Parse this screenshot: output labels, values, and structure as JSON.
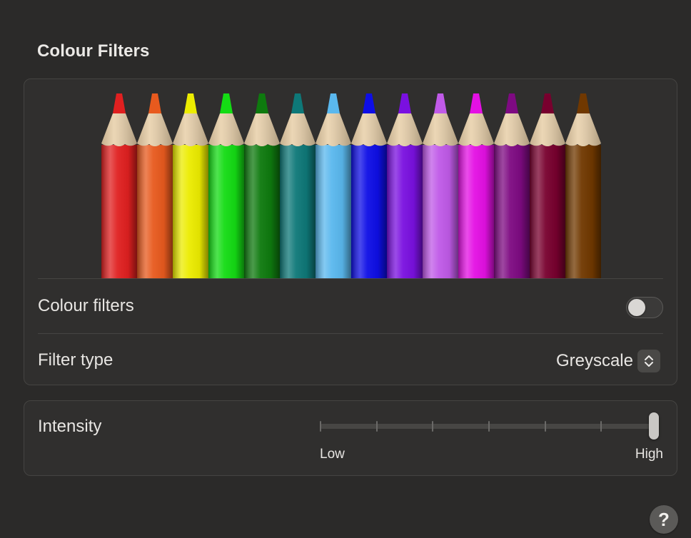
{
  "section": {
    "title": "Colour Filters"
  },
  "preview": {
    "pencil_colors": [
      "#e02020",
      "#e85a1e",
      "#ecec00",
      "#14dc14",
      "#0e7a0e",
      "#0e7878",
      "#5ab8ee",
      "#0e0ee6",
      "#7a10e0",
      "#c05ae8",
      "#e410e4",
      "#7e0a82",
      "#78002e",
      "#703800"
    ]
  },
  "colour_filters": {
    "label": "Colour filters",
    "enabled": false
  },
  "filter_type": {
    "label": "Filter type",
    "value": "Greyscale"
  },
  "intensity": {
    "label": "Intensity",
    "min_label": "Low",
    "max_label": "High",
    "value": 1.0,
    "ticks": 7
  },
  "help": {
    "symbol": "?"
  },
  "colors": {
    "background": "#2b2a29",
    "card": "#302f2e",
    "wood": "#e8cfa8"
  }
}
